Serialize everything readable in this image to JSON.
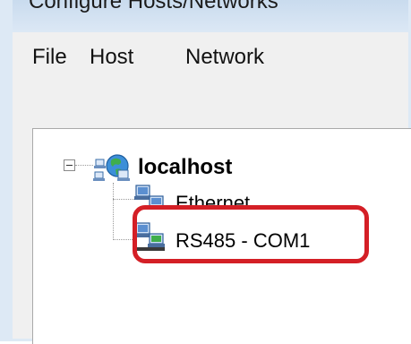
{
  "window": {
    "title": "Configure Hosts/Networks"
  },
  "menu": {
    "items": [
      "File",
      "Host",
      "Network"
    ]
  },
  "tree": {
    "root": {
      "label": "localhost",
      "icon": "network-globe-icon",
      "expanded": true
    },
    "children": [
      {
        "label": "Ethernet",
        "icon": "ethernet-computers-icon"
      },
      {
        "label": "RS485 - COM1",
        "icon": "serial-port-computers-icon",
        "highlighted": true
      }
    ]
  },
  "colors": {
    "highlight": "#d41f26",
    "frame": "#dde9f5"
  }
}
